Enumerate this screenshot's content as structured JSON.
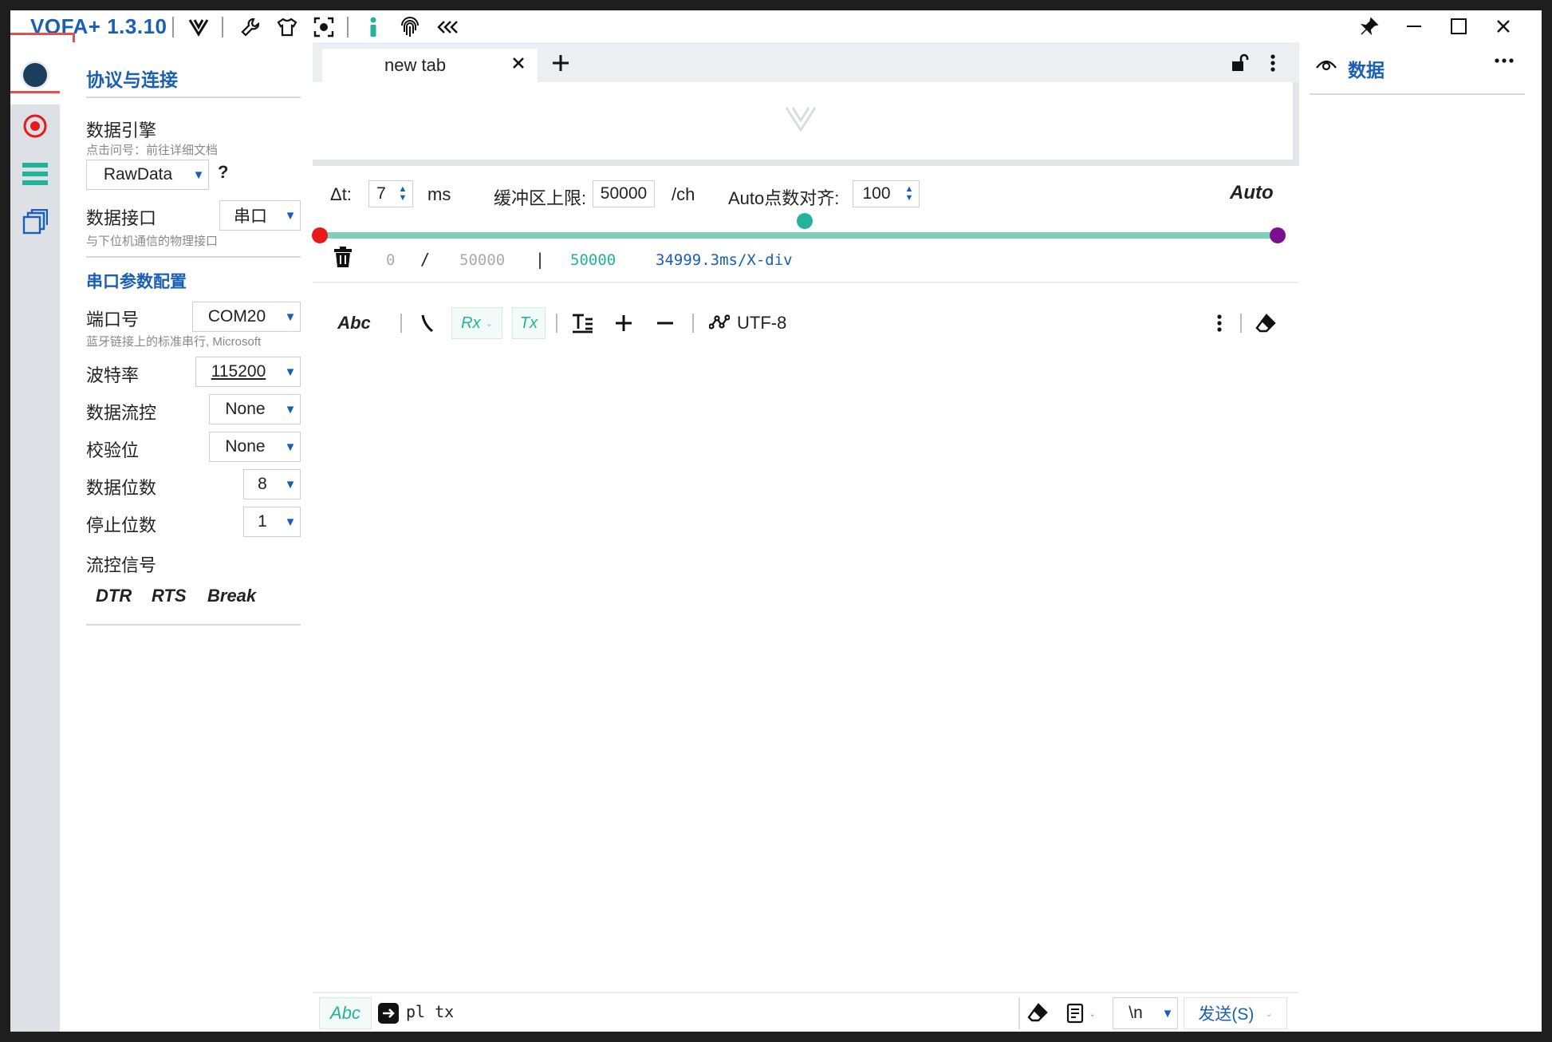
{
  "app": {
    "title": "VOFA+ 1.3.10",
    "toolbar_icons": [
      "logo-v-icon",
      "wrench-icon",
      "shirt-icon",
      "screenshot-icon",
      "info-icon",
      "fingerprint-icon",
      "collapse-icon"
    ]
  },
  "sidebar": {
    "section_protocol": "协议与连接",
    "engine_label": "数据引擎",
    "engine_hint": "点击问号：前往详细文档",
    "engine_value": "RawData",
    "engine_help": "?",
    "interface_label": "数据接口",
    "interface_value": "串口",
    "interface_hint": "与下位机通信的物理接口",
    "serial_section": "串口参数配置",
    "port_label": "端口号",
    "port_value": "COM20",
    "port_hint": "蓝牙链接上的标准串行, Microsoft",
    "baud_label": "波特率",
    "baud_value": "115200",
    "flow_label": "数据流控",
    "flow_value": "None",
    "parity_label": "校验位",
    "parity_value": "None",
    "databits_label": "数据位数",
    "databits_value": "8",
    "stopbits_label": "停止位数",
    "stopbits_value": "1",
    "flowsignal_label": "流控信号",
    "dtr": "DTR",
    "rts": "RTS",
    "break": "Break"
  },
  "tabs": [
    {
      "label": "new tab"
    }
  ],
  "plot": {
    "dt_label": "Δt:",
    "dt_value": "7",
    "dt_unit": "ms",
    "buffer_label": "缓冲区上限:",
    "buffer_value": "50000",
    "buffer_unit": "/ch",
    "align_label": "Auto点数对齐:",
    "align_value": "100",
    "auto_label": "Auto",
    "count_current": "0",
    "count_sep": "/",
    "count_total": "50000",
    "count_bar": "|",
    "count_window": "50000",
    "div_info": "34999.3ms/X-div"
  },
  "console": {
    "abc": "Abc",
    "rx": "Rx",
    "tx": "Tx",
    "encoding": "UTF-8"
  },
  "sendbar": {
    "abc": "Abc",
    "input_value": "pl tx",
    "newline": "\\n",
    "send_label": "发送(S)"
  },
  "rightpanel": {
    "title": "数据"
  },
  "colors": {
    "accent_blue": "#1a5fb4",
    "teal": "#25b29b",
    "slider_track": "#7fcfbd",
    "red_handle": "#e81919",
    "purple_handle": "#7a0f8f"
  }
}
